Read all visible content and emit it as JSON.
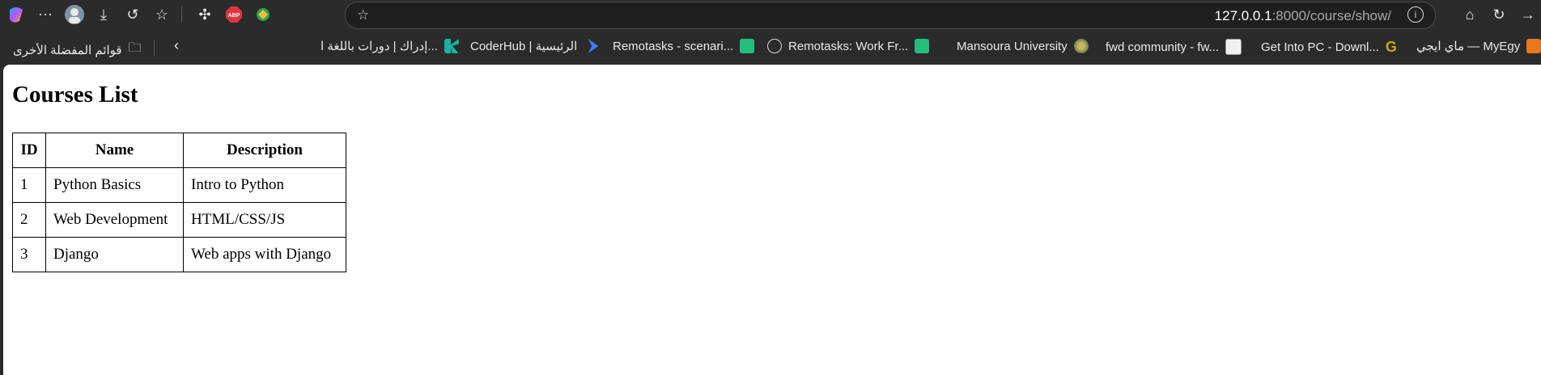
{
  "browser": {
    "url_host": "127.0.0.1",
    "url_rest": ":8000/course/show/",
    "bookmarks": [
      {
        "label": "ماي ايجي — MyEgy",
        "icon": "myegy-icon"
      },
      {
        "label": "Get Into PC - Downl...",
        "icon": "getintopc-icon"
      },
      {
        "label": "fwd community - fw...",
        "icon": "fwd-icon"
      },
      {
        "label": "Mansoura University",
        "icon": "mansoura-icon"
      },
      {
        "label": "Remotasks: Work Fr...",
        "icon": "remotasks-icon"
      },
      {
        "label": "Remotasks - scenari...",
        "icon": "globe-icon"
      },
      {
        "label": "CoderHub | الرئيسية",
        "icon": "coderhub-icon"
      },
      {
        "label": "إدراك | دورات باللغة ا...",
        "icon": "edraak-icon"
      }
    ],
    "other_favorites": "قوائم المفضلة الأخرى"
  },
  "page": {
    "title": "Courses List",
    "table": {
      "headers": [
        "ID",
        "Name",
        "Description"
      ],
      "rows": [
        [
          "1",
          "Python Basics",
          "Intro to Python"
        ],
        [
          "2",
          "Web Development",
          "HTML/CSS/JS"
        ],
        [
          "3",
          "Django",
          "Web apps with Django"
        ]
      ]
    }
  }
}
